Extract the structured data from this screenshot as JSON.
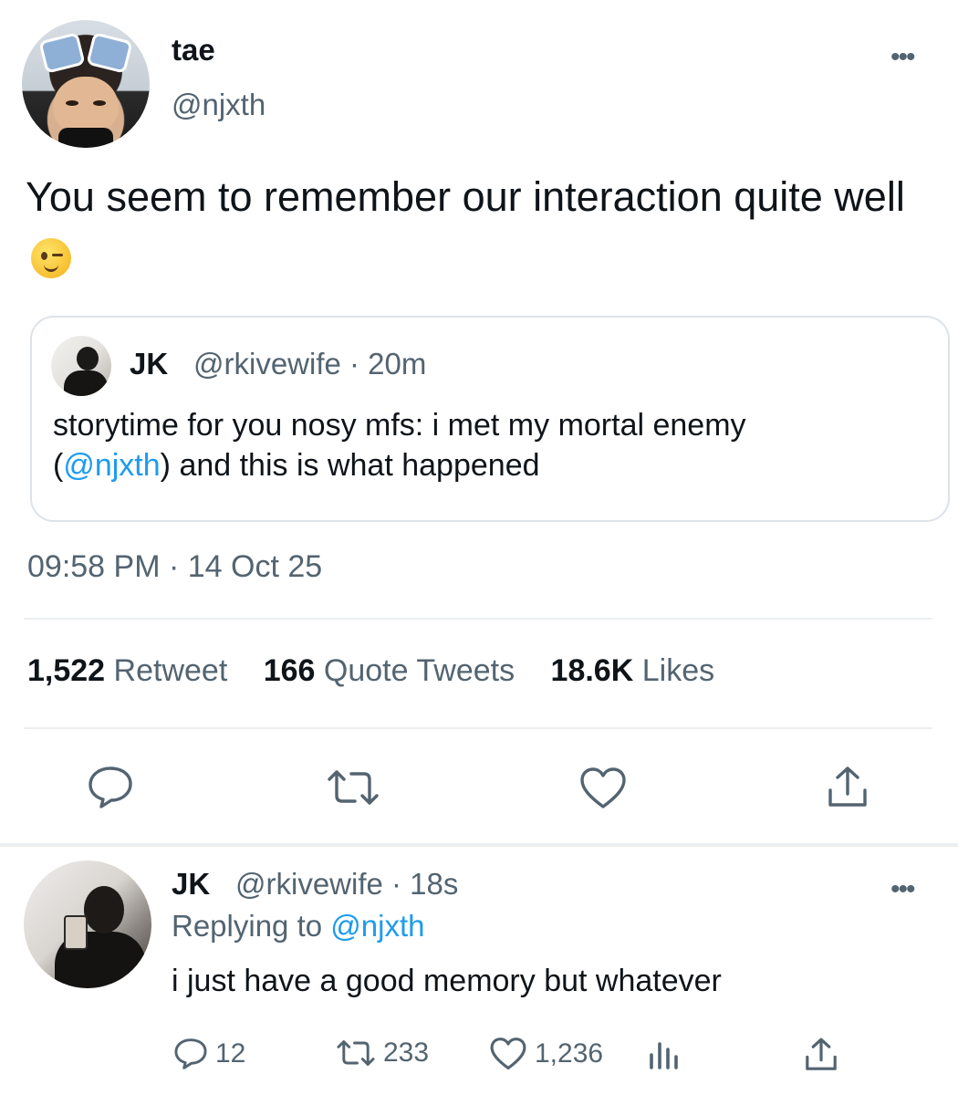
{
  "tweet": {
    "author_name": "tae",
    "author_handle": "@njxth",
    "text": "You seem to remember our interaction quite well",
    "timestamp": "09:58 PM · 14 Oct 25",
    "stats": {
      "retweets_count": "1,522",
      "retweets_label": "Retweet",
      "quotes_count": "166",
      "quotes_label": "Quote Tweets",
      "likes_count": "18.6K",
      "likes_label": "Likes"
    }
  },
  "quoted": {
    "author_name": "JK",
    "meta": "@rkivewife · 20m",
    "text_line1": "storytime for you nosy mfs: i met my mortal enemy",
    "text_open": "(",
    "mention": "@njxth",
    "text_close": ") and this is what happened"
  },
  "reply": {
    "author_name": "JK",
    "meta": "@rkivewife · 18s",
    "replying_prefix": "Replying to",
    "replying_handle": "@njxth",
    "text": "i just have a good memory but whatever",
    "replies_count": "12",
    "retweets_count": "233",
    "likes_count": "1,236"
  },
  "icons": {
    "more": "more-dots-icon",
    "reply": "reply-bubble-icon",
    "retweet": "retweet-icon",
    "like": "heart-icon",
    "share": "share-icon",
    "analytics": "analytics-bars-icon"
  },
  "colors": {
    "link": "#1d9bf0",
    "secondary_text": "#536471",
    "primary_text": "#0f1419",
    "divider": "#eceff1"
  }
}
